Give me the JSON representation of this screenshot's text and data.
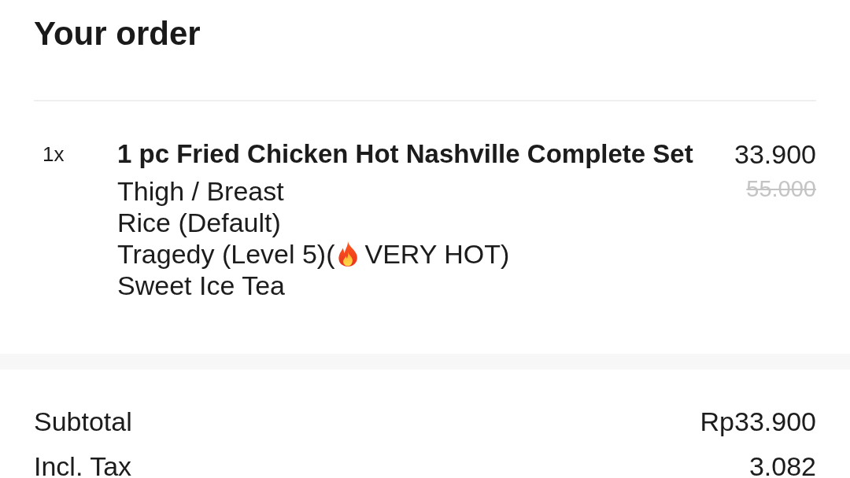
{
  "title": "Your order",
  "items": [
    {
      "quantity": "1x",
      "name": "1 pc Fried Chicken Hot Nashville Complete Set",
      "price": "33.900",
      "original_price": "55.000",
      "options": [
        {
          "kind": "text",
          "text": "Thigh / Breast"
        },
        {
          "kind": "text",
          "text": "Rice (Default)"
        },
        {
          "kind": "icon",
          "before": "Tragedy (Level 5)(",
          "after": "VERY HOT)"
        },
        {
          "kind": "text",
          "text": "Sweet Ice Tea"
        }
      ]
    }
  ],
  "summary": [
    {
      "label": "Subtotal",
      "value": "Rp33.900"
    },
    {
      "label": "Incl. Tax",
      "value": "3.082"
    }
  ]
}
